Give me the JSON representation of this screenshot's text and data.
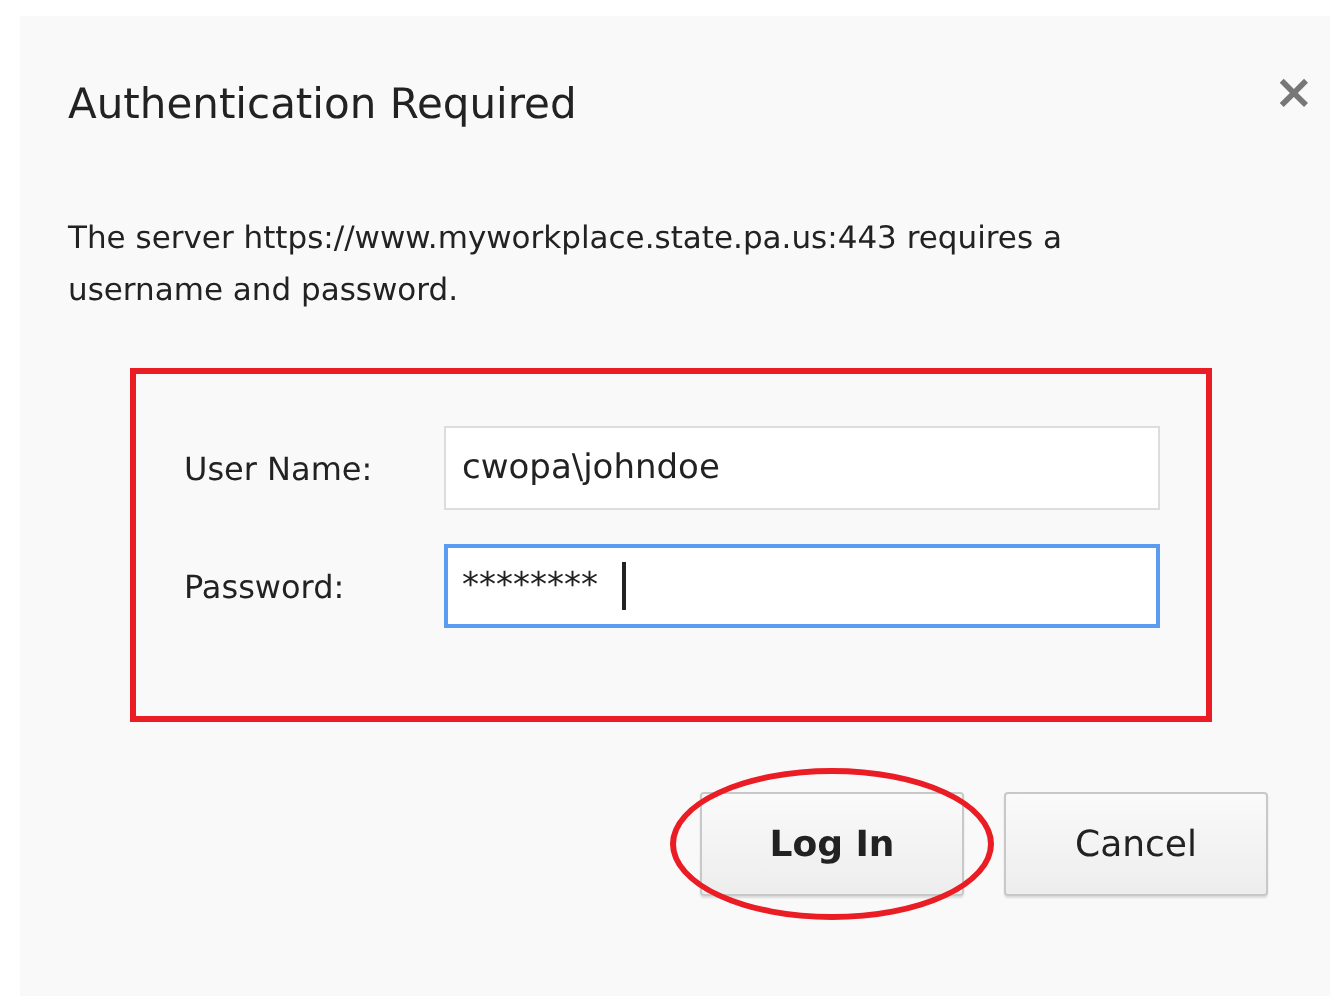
{
  "dialog": {
    "title": "Authentication Required",
    "close": "×",
    "message": "The server https://www.myworkplace.state.pa.us:443 requires a username and password."
  },
  "fields": [
    {
      "label": "User Name:",
      "value": "cwopa\\johndoe",
      "focused": false
    },
    {
      "label": "Password:",
      "value": "********",
      "focused": true
    }
  ],
  "fields_highlighted": true,
  "buttons": [
    {
      "label": "Log In",
      "default": true,
      "circled": true
    },
    {
      "label": "Cancel",
      "default": false,
      "circled": false
    }
  ]
}
